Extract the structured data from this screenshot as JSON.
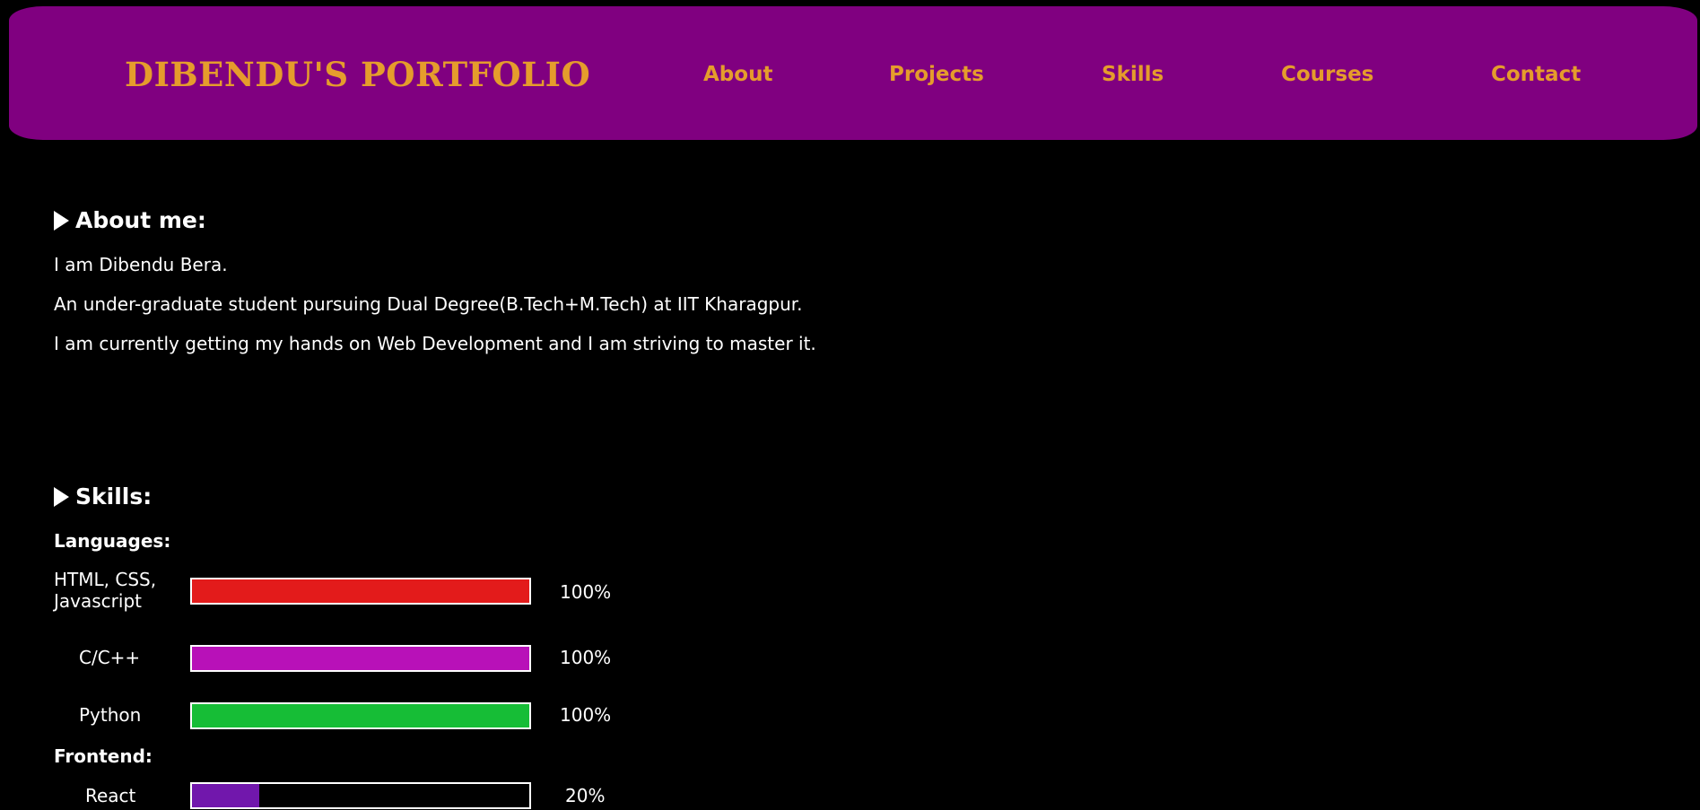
{
  "header": {
    "brand": "DIBENDU'S PORTFOLIO",
    "nav": [
      {
        "label": "About"
      },
      {
        "label": "Projects"
      },
      {
        "label": "Skills"
      },
      {
        "label": "Courses"
      },
      {
        "label": "Contact"
      }
    ],
    "colors": {
      "background": "#800080",
      "text": "#e59c2c"
    }
  },
  "about": {
    "heading": "About me:",
    "lines": [
      "I am Dibendu Bera.",
      "An under-graduate student pursuing Dual Degree(B.Tech+M.Tech) at IIT Kharagpur.",
      "I am currently getting my hands on Web Development and I am striving to master it."
    ]
  },
  "skills": {
    "heading": "Skills:",
    "groups": [
      {
        "title": "Languages:",
        "items": [
          {
            "name": "HTML, CSS, Javascript",
            "percent_label": "100%",
            "level": 1.0,
            "color": "#e31b1b"
          },
          {
            "name": "C/C++",
            "percent_label": "100%",
            "level": 1.0,
            "color": "#b811b8"
          },
          {
            "name": "Python",
            "percent_label": "100%",
            "level": 1.0,
            "color": "#16bd36"
          }
        ]
      },
      {
        "title": "Frontend:",
        "items": [
          {
            "name": "React",
            "percent_label": "20%",
            "level": 0.2,
            "color": "#7117ac"
          }
        ]
      }
    ]
  }
}
